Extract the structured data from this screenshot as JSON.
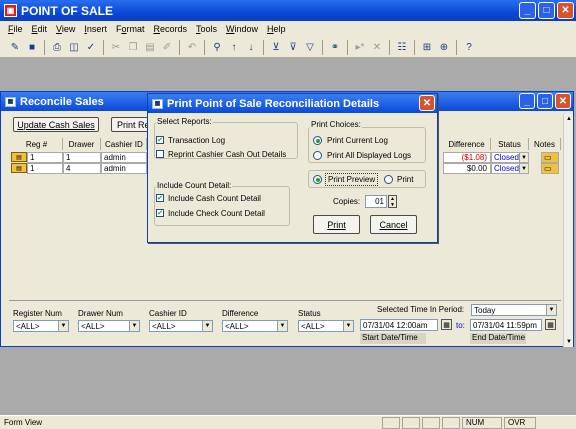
{
  "app": {
    "title": "POINT OF SALE"
  },
  "menu": [
    {
      "pre": "",
      "u": "F",
      "post": "ile"
    },
    {
      "pre": "",
      "u": "E",
      "post": "dit"
    },
    {
      "pre": "",
      "u": "V",
      "post": "iew"
    },
    {
      "pre": "",
      "u": "I",
      "post": "nsert"
    },
    {
      "pre": "F",
      "u": "o",
      "post": "rmat"
    },
    {
      "pre": "",
      "u": "R",
      "post": "ecords"
    },
    {
      "pre": "",
      "u": "T",
      "post": "ools"
    },
    {
      "pre": "",
      "u": "W",
      "post": "indow"
    },
    {
      "pre": "",
      "u": "H",
      "post": "elp"
    }
  ],
  "reconcile": {
    "title": "Reconcile Sales",
    "update_btn": "Update Cash Sales",
    "print_btn": "Print Re",
    "headers": [
      "Reg #",
      "Drawer",
      "Cashier ID",
      "Difference",
      "Status",
      "Notes"
    ],
    "rows": [
      {
        "reg": "1",
        "drawer": "1",
        "cashier": "admin",
        "difference": "($1.08)",
        "status": "Closed"
      },
      {
        "reg": "1",
        "drawer": "4",
        "cashier": "admin",
        "difference": "$0.00",
        "status": "Closed"
      }
    ],
    "filters": {
      "register_label": "Register Num",
      "drawer_label": "Drawer Num",
      "cashier_label": "Cashier ID",
      "difference_label": "Difference",
      "status_label": "Status",
      "all": "<ALL>",
      "selected_time_label": "Selected Time In Period:",
      "period_value": "Today",
      "start_value": "07/31/04 12:00am",
      "to_label": "to:",
      "end_value": "07/31/04 11:59pm",
      "start_label": "Start Date/Time",
      "end_label": "End Date/Time"
    }
  },
  "dialog": {
    "title": "Print Point of Sale Reconciliation Details",
    "select_reports": "Select Reports:",
    "transaction_log": "Transaction Log",
    "reprint": "Reprint Cashier Cash Out Details",
    "include_count": "Include Count Detail:",
    "include_cash": "Include Cash Count Detail",
    "include_check": "Include Check Count Detail",
    "print_choices": "Print Choices:",
    "print_current": "Print Current Log",
    "print_all": "Print All Displayed Logs",
    "print_preview": "Print Preview",
    "print_option": "Print",
    "copies_label": "Copies:",
    "copies_value": "01",
    "print_btn": "Print",
    "cancel_btn": "Cancel"
  },
  "status": {
    "view": "Form View",
    "num": "NUM",
    "ovr": "OVR"
  },
  "colors": {
    "negative": "#cc0000",
    "status_closed": "#0000cc"
  }
}
